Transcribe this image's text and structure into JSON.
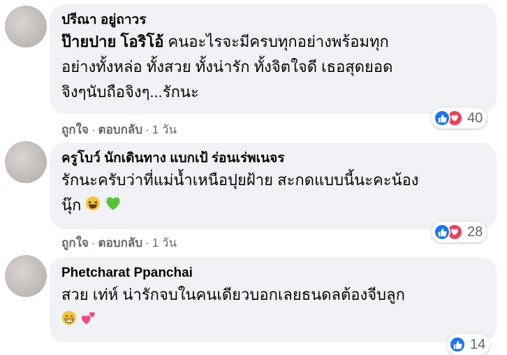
{
  "comments": [
    {
      "author": "ปรีณา อยู่ถาวร",
      "tag": "ป๊ายปาย โอริโอ้",
      "line1": "คนอะไรจะมีครบทุกอย่างพร้อมทุก",
      "line2": "อย่างทั้งหล่อ ทั้งสวย ทั้งน่ารัก ทั้งจิตใจดี เธอสุดยอด",
      "line3": "จิงๆนับถือจิงๆ...รักนะ",
      "reaction_count": "40",
      "like_label": "ถูกใจ",
      "reply_label": "ตอบกลับ",
      "time": "1 วัน"
    },
    {
      "author": "ครูโบว์ นักเดินทาง แบกเป้ ร่อนเร่พเนจร",
      "line1": "รักนะครับว่าที่แม่น้ำเหนือปุยฝ้าย สะกดแบบนี้นะคะน้อง",
      "line2": "นุ๊ก",
      "emojis": [
        "laughing-face",
        "green-heart"
      ],
      "reaction_count": "28",
      "like_label": "ถูกใจ",
      "reply_label": "ตอบกลับ",
      "time": "1 วัน"
    },
    {
      "author": "Phetcharat Ppanchai",
      "line1": "สวย เท่ห์ น่ารักจบในคนเดียวบอกเลยธนดลต้องจีบลูก",
      "emojis": [
        "grinning-face",
        "two-hearts"
      ],
      "reaction_count": "14"
    }
  ],
  "colors": {
    "bubble": "#f0f2f5",
    "meta": "#65676b",
    "like": "#1877f2",
    "love": "#f33e58"
  }
}
